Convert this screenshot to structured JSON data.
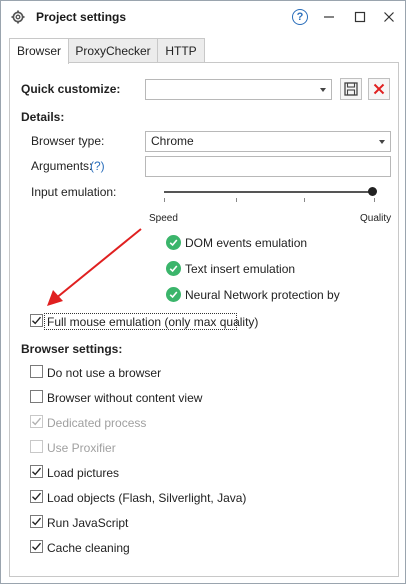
{
  "window": {
    "title": "Project settings",
    "help": "?"
  },
  "tabs": [
    {
      "label": "Browser",
      "active": true
    },
    {
      "label": "ProxyChecker",
      "active": false
    },
    {
      "label": "HTTP",
      "active": false
    }
  ],
  "quick_customize": {
    "label": "Quick customize:",
    "value": ""
  },
  "details": {
    "heading": "Details:",
    "browser_type_label": "Browser type:",
    "browser_type_value": "Chrome",
    "arguments_label": "Arguments:",
    "arguments_help": "(?)",
    "arguments_value": "",
    "input_emulation_label": "Input emulation:",
    "slider_level": 1.0,
    "speed_label": "Speed",
    "quality_label": "Quality"
  },
  "emulation_features": [
    "DOM events emulation",
    "Text insert emulation",
    "Neural Network protection bypas"
  ],
  "full_mouse": {
    "label": "Full mouse emulation (only max quality)",
    "checked": true
  },
  "browser_settings": {
    "heading": "Browser settings:",
    "items": [
      {
        "label": "Do not use a browser",
        "checked": false,
        "disabled": false
      },
      {
        "label": "Browser without content view",
        "checked": false,
        "disabled": false
      },
      {
        "label": "Dedicated process",
        "checked": true,
        "disabled": true
      },
      {
        "label": "Use Proxifier",
        "checked": false,
        "disabled": true
      },
      {
        "label": "Load pictures",
        "checked": true,
        "disabled": false
      },
      {
        "label": "Load objects (Flash, Silverlight, Java)",
        "checked": true,
        "disabled": false
      },
      {
        "label": "Run JavaScript",
        "checked": true,
        "disabled": false
      },
      {
        "label": "Cache cleaning",
        "checked": true,
        "disabled": false
      }
    ]
  },
  "colors": {
    "accent": "#2a6ebb",
    "green": "#3bb56b",
    "red_arrow": "#e02020"
  }
}
